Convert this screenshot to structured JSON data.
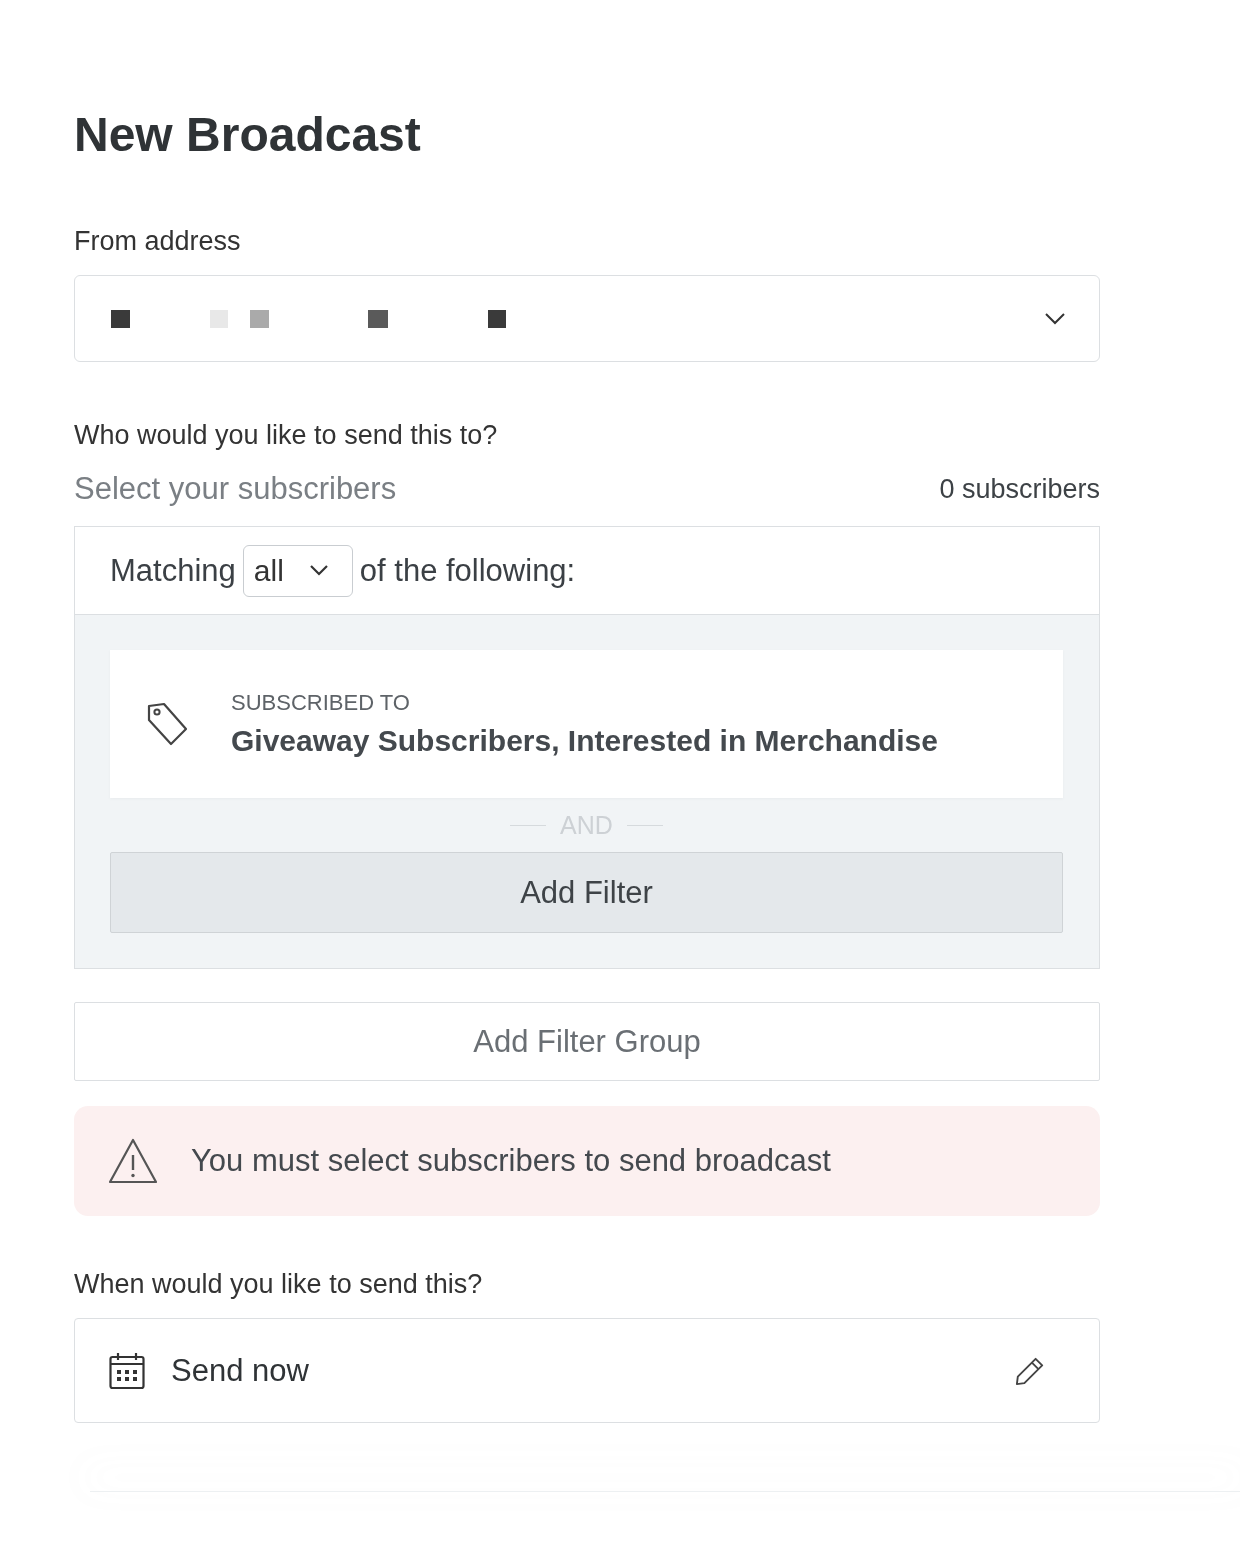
{
  "title": "New Broadcast",
  "from_address": {
    "label": "From address"
  },
  "recipients": {
    "label": "Who would you like to send this to?",
    "sublabel": "Select your subscribers",
    "count": "0 subscribers",
    "matching": {
      "prefix": "Matching",
      "value": "all",
      "suffix": "of the following:"
    },
    "filters": [
      {
        "heading": "SUBSCRIBED TO",
        "value": "Giveaway Subscribers, Interested in Merchandise"
      }
    ],
    "separator": "AND",
    "add_filter": "Add Filter",
    "add_filter_group": "Add Filter Group"
  },
  "alert": {
    "message": "You must select subscribers to send broadcast"
  },
  "schedule": {
    "label": "When would you like to send this?",
    "value": "Send now"
  }
}
